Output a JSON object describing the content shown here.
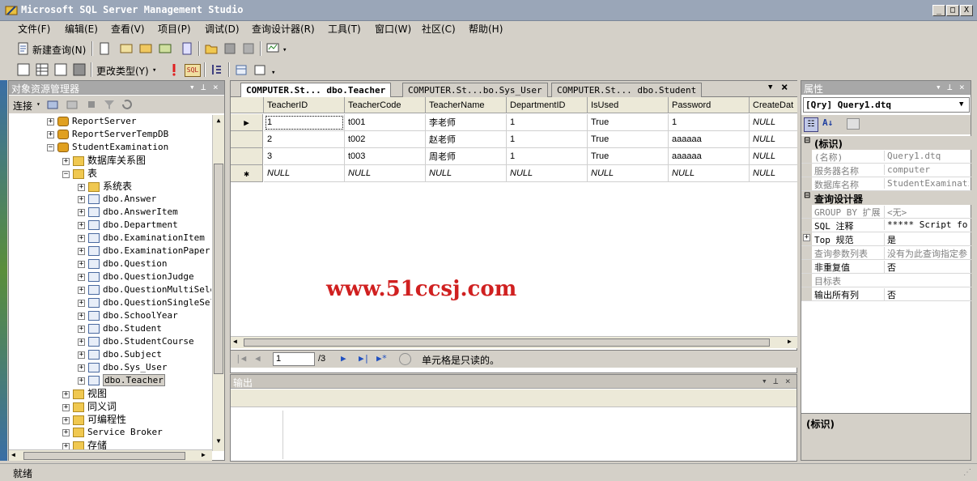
{
  "window": {
    "title": "Microsoft SQL Server Management Studio",
    "min": "_",
    "max": "□",
    "close": "X"
  },
  "menu": [
    "文件(F)",
    "编辑(E)",
    "查看(V)",
    "项目(P)",
    "调试(D)",
    "查询设计器(R)",
    "工具(T)",
    "窗口(W)",
    "社区(C)",
    "帮助(H)"
  ],
  "toolbar1": {
    "new_query": "新建查询(N)"
  },
  "toolbar2": {
    "change_type": "更改类型(Y)",
    "sql": "SQL"
  },
  "object_explorer": {
    "title": "对象资源管理器",
    "connect": "连接",
    "tree": [
      {
        "label": "ReportServer",
        "indent": 0,
        "exp": "+",
        "icon": "db"
      },
      {
        "label": "ReportServerTempDB",
        "indent": 0,
        "exp": "+",
        "icon": "db"
      },
      {
        "label": "StudentExamination",
        "indent": 0,
        "exp": "−",
        "icon": "db"
      },
      {
        "label": "数据库关系图",
        "indent": 1,
        "exp": "+",
        "icon": "folder"
      },
      {
        "label": "表",
        "indent": 1,
        "exp": "−",
        "icon": "folder"
      },
      {
        "label": "系统表",
        "indent": 2,
        "exp": "+",
        "icon": "folder"
      },
      {
        "label": "dbo.Answer",
        "indent": 2,
        "exp": "+",
        "icon": "tbl"
      },
      {
        "label": "dbo.AnswerItem",
        "indent": 2,
        "exp": "+",
        "icon": "tbl"
      },
      {
        "label": "dbo.Department",
        "indent": 2,
        "exp": "+",
        "icon": "tbl"
      },
      {
        "label": "dbo.ExaminationItem",
        "indent": 2,
        "exp": "+",
        "icon": "tbl"
      },
      {
        "label": "dbo.ExaminationPaper",
        "indent": 2,
        "exp": "+",
        "icon": "tbl"
      },
      {
        "label": "dbo.Question",
        "indent": 2,
        "exp": "+",
        "icon": "tbl"
      },
      {
        "label": "dbo.QuestionJudge",
        "indent": 2,
        "exp": "+",
        "icon": "tbl"
      },
      {
        "label": "dbo.QuestionMultiSelec",
        "indent": 2,
        "exp": "+",
        "icon": "tbl"
      },
      {
        "label": "dbo.QuestionSingleSele",
        "indent": 2,
        "exp": "+",
        "icon": "tbl"
      },
      {
        "label": "dbo.SchoolYear",
        "indent": 2,
        "exp": "+",
        "icon": "tbl"
      },
      {
        "label": "dbo.Student",
        "indent": 2,
        "exp": "+",
        "icon": "tbl"
      },
      {
        "label": "dbo.StudentCourse",
        "indent": 2,
        "exp": "+",
        "icon": "tbl"
      },
      {
        "label": "dbo.Subject",
        "indent": 2,
        "exp": "+",
        "icon": "tbl"
      },
      {
        "label": "dbo.Sys_User",
        "indent": 2,
        "exp": "+",
        "icon": "tbl"
      },
      {
        "label": "dbo.Teacher",
        "indent": 2,
        "exp": "+",
        "icon": "tbl",
        "selected": true
      },
      {
        "label": "视图",
        "indent": 1,
        "exp": "+",
        "icon": "folder"
      },
      {
        "label": "同义词",
        "indent": 1,
        "exp": "+",
        "icon": "folder"
      },
      {
        "label": "可编程性",
        "indent": 1,
        "exp": "+",
        "icon": "folder"
      },
      {
        "label": "Service Broker",
        "indent": 1,
        "exp": "+",
        "icon": "folder"
      },
      {
        "label": "存储",
        "indent": 1,
        "exp": "+",
        "icon": "folder"
      }
    ]
  },
  "tabs": [
    {
      "label": "COMPUTER.St... dbo.Teacher",
      "active": true
    },
    {
      "label": "COMPUTER.St...bo.Sys_User",
      "active": false
    },
    {
      "label": "COMPUTER.St... dbo.Student",
      "active": false
    }
  ],
  "grid": {
    "columns": [
      "TeacherID",
      "TeacherCode",
      "TeacherName",
      "DepartmentID",
      "IsUsed",
      "Password",
      "CreateDat"
    ],
    "rows": [
      {
        "marker": "▶",
        "cells": [
          "1",
          "t001",
          "李老师",
          "1",
          "True",
          "1",
          "NULL"
        ]
      },
      {
        "marker": "",
        "cells": [
          "2",
          "t002",
          "赵老师",
          "1",
          "True",
          "aaaaaa",
          "NULL"
        ]
      },
      {
        "marker": "",
        "cells": [
          "3",
          "t003",
          "周老师",
          "1",
          "True",
          "aaaaaa",
          "NULL"
        ]
      },
      {
        "marker": "✱",
        "cells": [
          "NULL",
          "NULL",
          "NULL",
          "NULL",
          "NULL",
          "NULL",
          "NULL"
        ]
      }
    ]
  },
  "watermark": "www.51ccsj.com",
  "nav": {
    "current": "1",
    "total": "/3",
    "status": "单元格是只读的。"
  },
  "output": {
    "title": "输出"
  },
  "properties": {
    "title": "属性",
    "object": "[Qry] Query1.dtq",
    "sections": [
      {
        "category": "(标识)",
        "rows": [
          {
            "name": "(名称)",
            "value": "Query1.dtq",
            "grey": true
          },
          {
            "name": "服务器名称",
            "value": "computer",
            "grey": true
          },
          {
            "name": "数据库名称",
            "value": "StudentExamination",
            "grey": true
          }
        ]
      },
      {
        "category": "查询设计器",
        "rows": [
          {
            "name": "GROUP BY 扩展",
            "value": "<无>",
            "grey": true
          },
          {
            "name": "SQL 注释",
            "value": "***** Script for S",
            "grey": false
          },
          {
            "name": "Top 规范",
            "value": "是",
            "grey": false,
            "exp": "+"
          },
          {
            "name": "查询参数列表",
            "value": "没有为此查询指定参",
            "grey": true
          },
          {
            "name": "非重复值",
            "value": "否",
            "grey": false
          },
          {
            "name": "目标表",
            "value": "",
            "grey": true
          },
          {
            "name": "输出所有列",
            "value": "否",
            "grey": false
          }
        ]
      }
    ],
    "description": "(标识)"
  },
  "status": {
    "text": "就绪"
  }
}
